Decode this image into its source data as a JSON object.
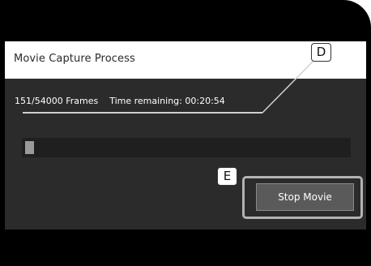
{
  "dialog": {
    "title": "Movie Capture Process",
    "frames_text": "151/54000 Frames",
    "time_remaining_text": "Time remaining: 00:20:54",
    "progress": 0.028,
    "stop_button_label": "Stop Movie"
  },
  "callouts": {
    "d": "D",
    "e": "E"
  },
  "colors": {
    "device_frame": "#000000",
    "panel": "#2b2b2b",
    "titlebar": "#ffffff",
    "button": "#5a5a5a",
    "highlight": "#b3b3b3"
  }
}
